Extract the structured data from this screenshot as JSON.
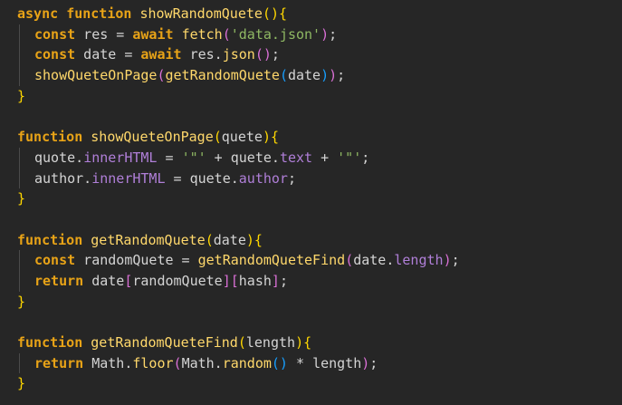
{
  "colors": {
    "background": "#262626",
    "keyword": "#e8a317",
    "function": "#ffd86b",
    "identifier": "#d4d4d4",
    "property": "#b07fd8",
    "string": "#8fb863",
    "bracket_level1": "#ffd700",
    "bracket_level2": "#da70d6",
    "bracket_level3": "#179fff"
  },
  "lines": [
    {
      "indent": 0,
      "tokens": [
        [
          "kw",
          "async"
        ],
        [
          "op",
          " "
        ],
        [
          "kw",
          "function"
        ],
        [
          "op",
          " "
        ],
        [
          "fn",
          "showRandomQuete"
        ],
        [
          "p1",
          "(){"
        ]
      ]
    },
    {
      "indent": 1,
      "tokens": [
        [
          "kw",
          "const"
        ],
        [
          "id",
          " res = "
        ],
        [
          "kw",
          "await"
        ],
        [
          "op",
          " "
        ],
        [
          "fn",
          "fetch"
        ],
        [
          "p2",
          "("
        ],
        [
          "st",
          "'data.json'"
        ],
        [
          "p2",
          ")"
        ],
        [
          "op",
          ";"
        ]
      ]
    },
    {
      "indent": 1,
      "tokens": [
        [
          "kw",
          "const"
        ],
        [
          "id",
          " date = "
        ],
        [
          "kw",
          "await"
        ],
        [
          "id",
          " res."
        ],
        [
          "fn",
          "json"
        ],
        [
          "p2",
          "()"
        ],
        [
          "op",
          ";"
        ]
      ]
    },
    {
      "indent": 1,
      "tokens": [
        [
          "fn",
          "showQueteOnPage"
        ],
        [
          "p2",
          "("
        ],
        [
          "fn",
          "getRandomQuete"
        ],
        [
          "p3",
          "("
        ],
        [
          "id",
          "date"
        ],
        [
          "p3",
          ")"
        ],
        [
          "p2",
          ")"
        ],
        [
          "op",
          ";"
        ]
      ]
    },
    {
      "indent": 0,
      "tokens": [
        [
          "p1",
          "}"
        ]
      ]
    },
    {
      "indent": 0,
      "tokens": []
    },
    {
      "indent": 0,
      "tokens": [
        [
          "kw",
          "function"
        ],
        [
          "op",
          " "
        ],
        [
          "fn",
          "showQueteOnPage"
        ],
        [
          "p1",
          "("
        ],
        [
          "id",
          "quete"
        ],
        [
          "p1",
          "){"
        ]
      ]
    },
    {
      "indent": 1,
      "tokens": [
        [
          "id",
          "quote."
        ],
        [
          "pr",
          "innerHTML"
        ],
        [
          "op",
          " = "
        ],
        [
          "st",
          "'\"'"
        ],
        [
          "op",
          " + "
        ],
        [
          "id",
          "quete."
        ],
        [
          "pr",
          "text"
        ],
        [
          "op",
          " + "
        ],
        [
          "st",
          "'\"'"
        ],
        [
          "op",
          ";"
        ]
      ]
    },
    {
      "indent": 1,
      "tokens": [
        [
          "id",
          "author."
        ],
        [
          "pr",
          "innerHTML"
        ],
        [
          "op",
          " = "
        ],
        [
          "id",
          "quete."
        ],
        [
          "pr",
          "author"
        ],
        [
          "op",
          ";"
        ]
      ]
    },
    {
      "indent": 0,
      "tokens": [
        [
          "p1",
          "}"
        ]
      ]
    },
    {
      "indent": 0,
      "tokens": []
    },
    {
      "indent": 0,
      "tokens": [
        [
          "kw",
          "function"
        ],
        [
          "op",
          " "
        ],
        [
          "fn",
          "getRandomQuete"
        ],
        [
          "p1",
          "("
        ],
        [
          "id",
          "date"
        ],
        [
          "p1",
          "){"
        ]
      ]
    },
    {
      "indent": 1,
      "tokens": [
        [
          "kw",
          "const"
        ],
        [
          "id",
          " randomQuete = "
        ],
        [
          "fn",
          "getRandomQueteFind"
        ],
        [
          "p2",
          "("
        ],
        [
          "id",
          "date."
        ],
        [
          "pr",
          "length"
        ],
        [
          "p2",
          ")"
        ],
        [
          "op",
          ";"
        ]
      ]
    },
    {
      "indent": 1,
      "tokens": [
        [
          "kw",
          "return"
        ],
        [
          "id",
          " date"
        ],
        [
          "p2",
          "["
        ],
        [
          "id",
          "randomQuete"
        ],
        [
          "p2",
          "]["
        ],
        [
          "id",
          "hash"
        ],
        [
          "p2",
          "]"
        ],
        [
          "op",
          ";"
        ]
      ]
    },
    {
      "indent": 0,
      "tokens": [
        [
          "p1",
          "}"
        ]
      ]
    },
    {
      "indent": 0,
      "tokens": []
    },
    {
      "indent": 0,
      "tokens": [
        [
          "kw",
          "function"
        ],
        [
          "op",
          " "
        ],
        [
          "fn",
          "getRandomQueteFind"
        ],
        [
          "p1",
          "("
        ],
        [
          "id",
          "length"
        ],
        [
          "p1",
          "){"
        ]
      ]
    },
    {
      "indent": 1,
      "tokens": [
        [
          "kw",
          "return"
        ],
        [
          "id",
          " Math."
        ],
        [
          "fn",
          "floor"
        ],
        [
          "p2",
          "("
        ],
        [
          "id",
          "Math."
        ],
        [
          "fn",
          "random"
        ],
        [
          "p3",
          "()"
        ],
        [
          "op",
          " * "
        ],
        [
          "id",
          "length"
        ],
        [
          "p2",
          ")"
        ],
        [
          "op",
          ";"
        ]
      ]
    },
    {
      "indent": 0,
      "tokens": [
        [
          "p1",
          "}"
        ]
      ]
    }
  ]
}
